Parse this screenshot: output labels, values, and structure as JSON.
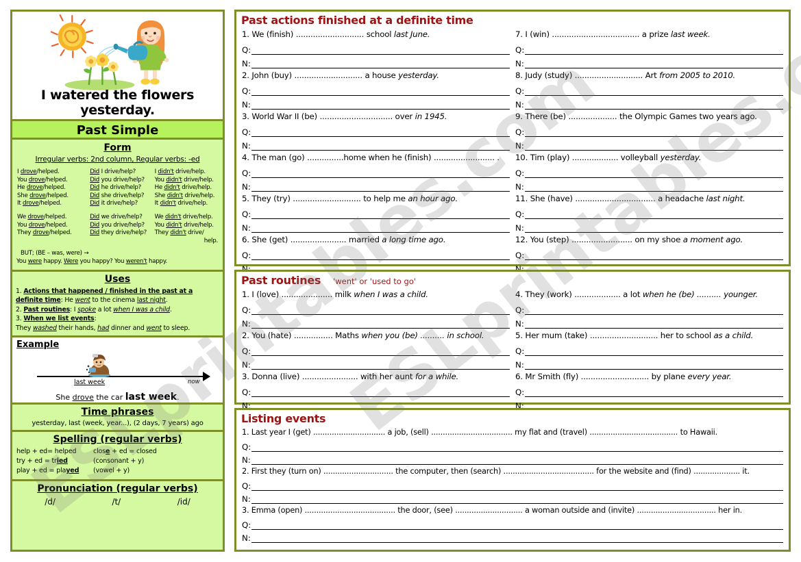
{
  "worksheet": {
    "illustration_caption": "I watered the flowers yesterday.",
    "tense_title": "Past Simple"
  },
  "form": {
    "title": "Form",
    "subtitle": "Irregular verbs: 2nd column,   Regular verbs: -ed",
    "rows_singular": [
      {
        "aff_pre": "I ",
        "aff_u": "drove",
        "aff_post": "/helped.",
        "q_u": "Did",
        "q_post": " I drive/help?",
        "n_pre": "I ",
        "n_u": "didn't",
        "n_post": " drive/help."
      },
      {
        "aff_pre": "You ",
        "aff_u": "drove",
        "aff_post": "/helped.",
        "q_u": "Did",
        "q_post": " you drive/help?",
        "n_pre": "You ",
        "n_u": "didn't",
        "n_post": " drive/help."
      },
      {
        "aff_pre": "He ",
        "aff_u": "drove",
        "aff_post": "/helped.",
        "q_u": "Did",
        "q_post": " he drive/help?",
        "n_pre": "He ",
        "n_u": "didn't",
        "n_post": " drive/help."
      },
      {
        "aff_pre": "She ",
        "aff_u": "drove",
        "aff_post": "/helped.",
        "q_u": "Did",
        "q_post": " she drive/help?",
        "n_pre": "She ",
        "n_u": "didn't",
        "n_post": " drive/help."
      },
      {
        "aff_pre": "It ",
        "aff_u": "drove",
        "aff_post": "/helped.",
        "q_u": "Did",
        "q_post": " it drive/help?",
        "n_pre": "It ",
        "n_u": "didn't",
        "n_post": " drive/help."
      }
    ],
    "rows_plural": [
      {
        "aff_pre": "We ",
        "aff_u": "drove",
        "aff_post": "/helped.",
        "q_u": "Did",
        "q_post": " we drive/help?",
        "n_pre": "We ",
        "n_u": "didn't",
        "n_post": " drive/help."
      },
      {
        "aff_pre": "You ",
        "aff_u": "drove",
        "aff_post": "/helped.",
        "q_u": "Did",
        "q_post": " you drive/help?",
        "n_pre": "You ",
        "n_u": "didn't",
        "n_post": " drive/help."
      },
      {
        "aff_pre": "They ",
        "aff_u": "drove",
        "aff_post": "/helped.",
        "q_u": "Did",
        "q_post": " they drive/help?",
        "n_pre": "They ",
        "n_u": "didn't",
        "n_post": " drive/"
      }
    ],
    "plural_overflow": "help.",
    "but_line": "BUT; (BE – was, were) →",
    "be_pre": "You ",
    "be_u1": "were",
    "be_mid": " happy.   ",
    "be_u2": "Were",
    "be_mid2": " you happy? You ",
    "be_u3": "weren't",
    "be_post": " happy."
  },
  "uses": {
    "title": "Uses",
    "item1_num": "1. ",
    "item1_bold": "Actions that happened / finished in the past at a definite time",
    "item1_rest": ":        He ",
    "item1_verb": "went",
    "item1_tail": " to the cinema ",
    "item1_time": "last night",
    "item1_end": ".",
    "item2_num": "2. ",
    "item2_bold": "Past routines",
    "item2_rest": ":       I ",
    "item2_verb": "spoke",
    "item2_tail": " a lot ",
    "item2_time": "when I was a child",
    "item2_end": ".",
    "item3_num": "3. ",
    "item3_bold": "When we list events",
    "item3_rest": ":",
    "item3_line_pre": " They ",
    "item3_v1": "washed",
    "item3_m1": " their hands, ",
    "item3_v2": "had",
    "item3_m2": " dinner and ",
    "item3_v3": "went",
    "item3_m3": " to sleep."
  },
  "example": {
    "title": "Example",
    "label_past": "last week",
    "label_now": "now",
    "sentence_pre": "She ",
    "sentence_verb": "drove",
    "sentence_mid": " the car ",
    "sentence_bold": "last week",
    "sentence_end": "."
  },
  "time_phrases": {
    "title": "Time phrases",
    "text": "yesterday, last (week, year...), (2 days, 7 years) ago"
  },
  "spelling": {
    "title_main": "Spelling",
    "title_sub": "(regular verbs)",
    "row1_a": "help + ed= helped",
    "row1_b_pre": "clos",
    "row1_b_bold": "e",
    "row1_b_post": " + ed = closed",
    "row2_a_pre": "try + ed = tr",
    "row2_a_bold": "ied",
    "row2_b": "(consonant + y)",
    "row3_a_pre": "play + ed = pla",
    "row3_a_bold": "yed",
    "row3_b": "(vowel + y)"
  },
  "pronunciation": {
    "title_main": "Pronunciation",
    "title_sub": "(regular verbs)",
    "sounds": [
      "/d/",
      "/t/",
      "/id/"
    ]
  },
  "exercises": {
    "definite": {
      "header": "Past actions finished at a definite time",
      "answer_labels": {
        "q": "Q:",
        "n": "N:"
      },
      "left": [
        {
          "pre": "1. We (finish) ............................ school ",
          "ital": "last June."
        },
        {
          "pre": "2. John (buy) ............................ a house ",
          "ital": "yesterday."
        },
        {
          "pre": "3. World War II (be) .............................. over ",
          "ital": "in 1945."
        },
        {
          "pre": "4. The man (go) ...............home when he (finish) ......................... .",
          "ital": ""
        },
        {
          "pre": "5. They (try) ............................ to help me ",
          "ital": "an hour ago."
        },
        {
          "pre": "6. She (get) ....................... married ",
          "ital": "a long time ago."
        }
      ],
      "right": [
        {
          "pre": "7. I (win) .................................... a prize ",
          "ital": "last week."
        },
        {
          "pre": "8. Judy (study) ............................ Art ",
          "ital": "from 2005 to 2010."
        },
        {
          "pre": "9. There (be) .................... the Olympic Games two years ago.",
          "ital": ""
        },
        {
          "pre": "10. Tim (play) ................... volleyball ",
          "ital": "yesterday."
        },
        {
          "pre": "11. She (have) ................................. a headache ",
          "ital": "last night."
        },
        {
          "pre": "12. You (step) ......................... on my shoe ",
          "ital": "a moment ago."
        }
      ]
    },
    "routines": {
      "header": "Past routines",
      "subheader": "'went'  or  'used to go'",
      "answer_labels": {
        "q": "Q:",
        "n": "N:"
      },
      "left": [
        {
          "pre": "1. I (love) ..................... milk ",
          "ital": "when I was a child."
        },
        {
          "pre": "2. You (hate) ................ Maths ",
          "ital": "when you (be) .......... in school."
        },
        {
          "pre": "3. Donna (live) ....................... with her aunt ",
          "ital": "for a while."
        }
      ],
      "right": [
        {
          "pre": "4. They (work) ................... a lot ",
          "ital": "when he (be) .......... younger."
        },
        {
          "pre": "5. Her mum (take) ............................ her to school ",
          "ital": "as a child."
        },
        {
          "pre": "6. Mr Smith (fly) ............................ by plane ",
          "ital": "every year."
        }
      ]
    },
    "listing": {
      "header": "Listing events",
      "answer_labels": {
        "q": "Q:",
        "n": "N:"
      },
      "items": [
        {
          "pre": "1. Last year I (get) ............................... a job, (sell) ................................... my flat and (travel) ...................................... to Hawaii.",
          "ital": ""
        },
        {
          "pre": "2. First they (turn on) .............................. the computer, then (search) ....................................... for the website and (find) .................... it.",
          "ital": ""
        },
        {
          "pre": "3. Emma (open) ....................................... the door, (see) ............................. a woman outside and (invite) .................................. her in.",
          "ital": ""
        }
      ]
    }
  },
  "watermark": {
    "line1": "ESLprintables.com",
    "line2": "ESLprintables.com"
  },
  "colors": {
    "border": "#7d8f27",
    "panel_green": "#d5f9a0",
    "band_green": "#b5f25e",
    "header_red": "#9e1414"
  }
}
